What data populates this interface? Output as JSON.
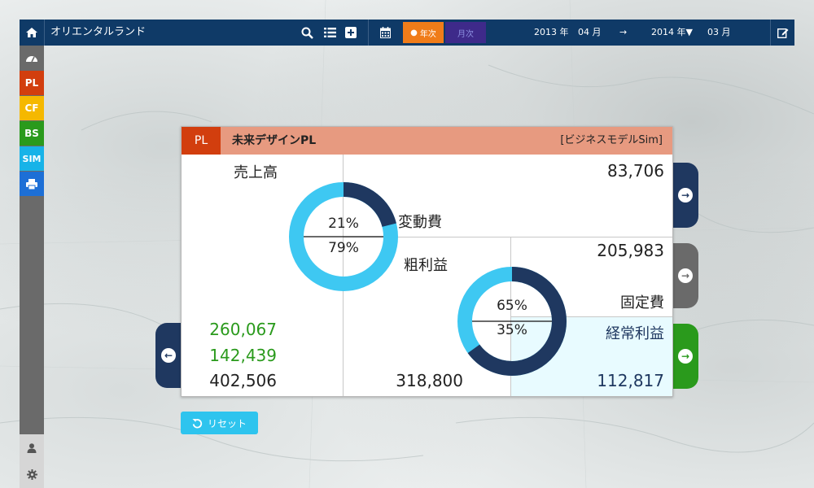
{
  "app": {
    "title": "オリエンタルランド"
  },
  "period": {
    "year_toggle": "年次",
    "month_toggle": "月次",
    "start_year": "2013 年",
    "start_month": "04 月",
    "arrow": "→",
    "end_year": "2014 年▼",
    "end_month": "03 月"
  },
  "sidebar": {
    "items": [
      {
        "label": "",
        "icon": "dashboard-icon",
        "color": "#6a6a6a"
      },
      {
        "label": "PL",
        "color": "#d23e0e"
      },
      {
        "label": "CF",
        "color": "#f5b800"
      },
      {
        "label": "BS",
        "color": "#2a9a1c"
      },
      {
        "label": "SIM",
        "color": "#17b3e8"
      },
      {
        "label": "",
        "icon": "print-icon",
        "color": "#1d6fd6"
      }
    ]
  },
  "card": {
    "badge": "PL",
    "title": "未来デザインPL",
    "tag": "[ビジネスモデルSim]",
    "sales_label": "売上高",
    "sales_value": "83,706",
    "variable_cost_label": "変動費",
    "gross_profit_label": "粗利益",
    "fixed_cost_value": "205,983",
    "fixed_cost_label": "固定費",
    "ordinary_profit_label": "経常利益",
    "left_value_1": "260,067",
    "left_value_2": "142,439",
    "left_value_3": "402,506",
    "center_value": "318,800",
    "ordinary_profit_value": "112,817",
    "donut1": {
      "top_pct": "21%",
      "bottom_pct": "79%",
      "fraction": 0.21
    },
    "donut2": {
      "top_pct": "65%",
      "bottom_pct": "35%",
      "fraction": 0.65
    }
  },
  "reset_label": "リセット",
  "colors": {
    "topbar": "#0f3a67",
    "navy": "#1f3860",
    "light_blue": "#3ec8f2",
    "green": "#2a9a1c",
    "gray": "#6a6a6a"
  }
}
